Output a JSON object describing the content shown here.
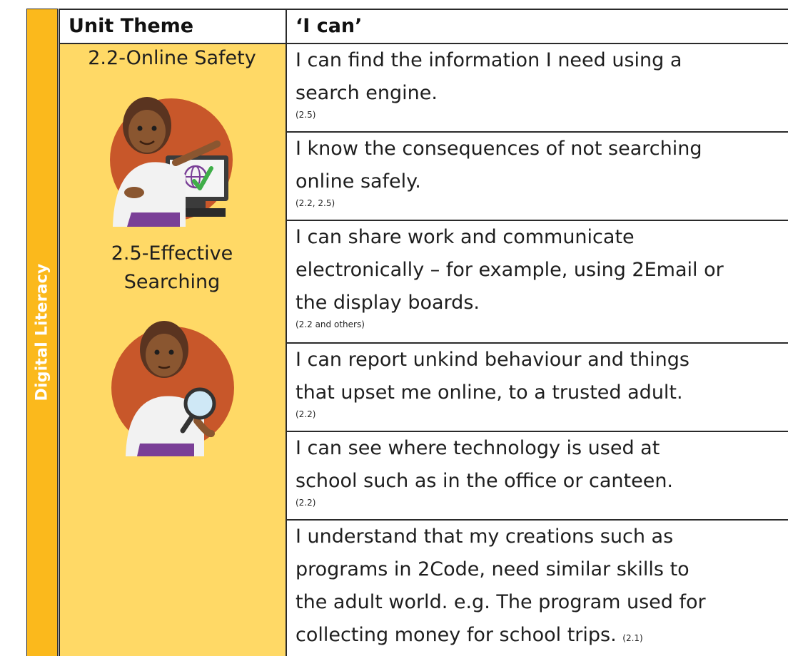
{
  "sidebar": {
    "label": "Digital Literacy"
  },
  "header": {
    "unit_theme": "Unit Theme",
    "i_can": "‘I can’"
  },
  "themes": [
    {
      "title": "2.2-Online Safety"
    },
    {
      "title_line1": "2.5-Effective",
      "title_line2": "Searching"
    }
  ],
  "rows": [
    {
      "lines": [
        "I can find the information I need using a",
        "search engine."
      ],
      "ref": "(2.5)"
    },
    {
      "lines": [
        "I know the consequences of not searching",
        "online safely."
      ],
      "ref": "(2.2, 2.5)"
    },
    {
      "lines": [
        "I can share work and communicate",
        "electronically – for example, using 2Email or",
        "the display boards."
      ],
      "ref": "(2.2 and others)"
    },
    {
      "lines": [
        "I can report unkind behaviour and things",
        "that upset me online, to a trusted adult."
      ],
      "ref": "(2.2)"
    },
    {
      "lines": [
        "I can see where technology is used at",
        "school such as in the office or canteen."
      ],
      "ref": "(2.2)"
    },
    {
      "lines": [
        "I understand that my creations such as",
        "programs in 2Code, need similar skills to",
        "the adult world. e.g. The program used for",
        "collecting money for school trips."
      ],
      "ref": "(2.1)"
    }
  ],
  "colors": {
    "sidebar": "#fbb91c",
    "theme_column": "#ffd966",
    "avatar_bg": "#c8572a"
  },
  "icons": [
    "online-safety-avatar",
    "globe-check-icon",
    "effective-searching-avatar",
    "magnifier-icon"
  ]
}
